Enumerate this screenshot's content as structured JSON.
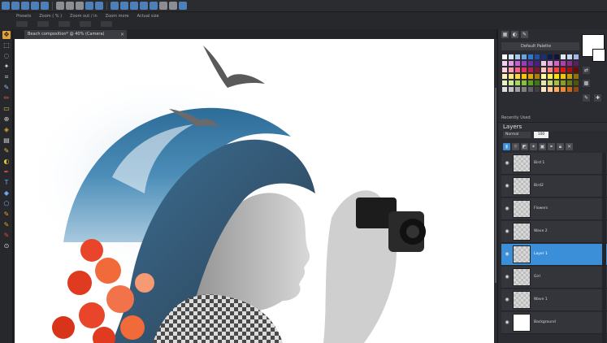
{
  "optionsbar": {
    "labels": [
      "Presets",
      "Zoom ( % )",
      "Zoom out / in",
      "Zoom more",
      "Actual size"
    ]
  },
  "document": {
    "tab_title": "Beach composition* @ 40% (Camera)",
    "close_glyph": "×"
  },
  "tools": [
    "move-icon",
    "select-icon",
    "lasso-icon",
    "magic-wand-icon",
    "crop-icon",
    "eyedropper-icon",
    "brush-icon",
    "eraser-icon",
    "clone-icon",
    "fill-icon",
    "gradient-icon",
    "text-icon",
    "shape-icon",
    "pen-icon",
    "zoom-icon"
  ],
  "materials": {
    "swatch_set": "Default Palette",
    "palette_colors": [
      "#ffffff",
      "#d6e6f6",
      "#a4c8ee",
      "#68a6e8",
      "#2f79d6",
      "#1f50a8",
      "#16307a",
      "#0e1c4a",
      "#10143a",
      "#dfe8f8",
      "#c6d6f2",
      "#9fb8e6",
      "#f4d0f2",
      "#e29be0",
      "#c85fd6",
      "#9a39c2",
      "#6e2aa6",
      "#4a1d84",
      "#f0c8e8",
      "#e49ad8",
      "#d564c8",
      "#b53db0",
      "#8a2a8c",
      "#5e1d62",
      "#ffd2dc",
      "#ff9ab2",
      "#ff5e86",
      "#e6305c",
      "#b71f44",
      "#7e1630",
      "#ffc0c0",
      "#ff8080",
      "#ff4040",
      "#e01818",
      "#a81010",
      "#700a0a",
      "#fff2b8",
      "#ffe680",
      "#ffd640",
      "#ffc400",
      "#e0a600",
      "#b07e00",
      "#fff8a0",
      "#ffee50",
      "#ffe000",
      "#f0c800",
      "#c8a000",
      "#907400",
      "#e8f4c0",
      "#cce890",
      "#a8d860",
      "#84c430",
      "#5ea018",
      "#3e7810",
      "#dfe8a8",
      "#c8d870",
      "#a8c040",
      "#88a020",
      "#687c10",
      "#4a5808",
      "#e0e0e0",
      "#c0c0c0",
      "#a0a0a0",
      "#808080",
      "#606060",
      "#404040",
      "#ffe4c0",
      "#ffc890",
      "#ffa860",
      "#f08830",
      "#c86818",
      "#904810"
    ],
    "recently_used_label": "Recently Used"
  },
  "layers": {
    "title": "Layers",
    "blend_mode": "Normal",
    "opacity": "100",
    "items": [
      {
        "name": "Bird 1",
        "selected": false,
        "thumb": "checker"
      },
      {
        "name": "Bird2",
        "selected": false,
        "thumb": "checker"
      },
      {
        "name": "Flowers",
        "selected": false,
        "thumb": "checker"
      },
      {
        "name": "Wave 2",
        "selected": false,
        "thumb": "checker"
      },
      {
        "name": "Layer 1",
        "selected": true,
        "thumb": "checker"
      },
      {
        "name": "Girl",
        "selected": false,
        "thumb": "checker"
      },
      {
        "name": "Wave 1",
        "selected": false,
        "thumb": "checker"
      },
      {
        "name": "Background",
        "selected": false,
        "thumb": "white"
      }
    ]
  },
  "colors": {
    "selection": "#3b8fd9",
    "panel_bg": "#2b2c31",
    "canvas_bg": "#ffffff"
  }
}
